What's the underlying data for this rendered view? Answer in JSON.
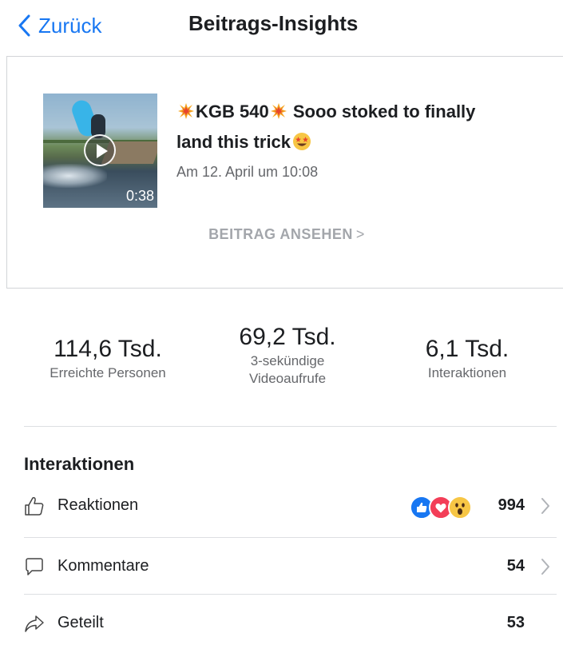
{
  "nav": {
    "back_label": "Zurück",
    "title": "Beitrags-Insights"
  },
  "post": {
    "title_line1": "KGB 540",
    "title_line1_rest": " Sooo stoked to finally",
    "title_line2": "land this trick",
    "date": "Am 12. April um 10:08",
    "video_duration": "0:38",
    "view_post_label": "BEITRAG ANSEHEN",
    "view_post_chevron": ">"
  },
  "stats": [
    {
      "value": "114,6 Tsd.",
      "label": "Erreichte Personen"
    },
    {
      "value": "69,2 Tsd.",
      "label_line1": "3-sekündige",
      "label_line2": "Videoaufrufe"
    },
    {
      "value": "6,1 Tsd.",
      "label": "Interaktionen"
    }
  ],
  "interactions": {
    "section_title": "Interaktionen",
    "rows": [
      {
        "label": "Reaktionen",
        "value": "994",
        "icon": "thumbs-up-icon",
        "reactions": [
          "like",
          "love",
          "wow"
        ]
      },
      {
        "label": "Kommentare",
        "value": "54",
        "icon": "comment-icon"
      },
      {
        "label": "Geteilt",
        "value": "53",
        "icon": "share-icon"
      }
    ]
  },
  "colors": {
    "accent": "#1877f2",
    "like": "#1877f2",
    "love": "#f33e58",
    "wow": "#f7c645"
  }
}
